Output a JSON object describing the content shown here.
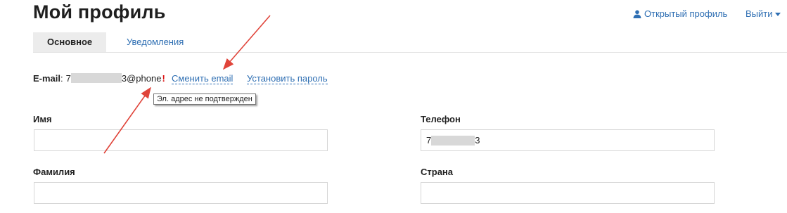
{
  "page": {
    "title": "Мой профиль"
  },
  "top_links": {
    "open_profile": "Открытый профиль",
    "logout": "Выйти"
  },
  "tabs": [
    {
      "label": "Основное",
      "active": true
    },
    {
      "label": "Уведомления",
      "active": false
    }
  ],
  "email": {
    "label": "E-mail",
    "value_start": "7",
    "value_end": "3@phone",
    "warning_mark": "!",
    "change_label": "Сменить email",
    "set_password_label": "Установить пароль",
    "tooltip": "Эл. адрес не подтвержден"
  },
  "form": {
    "name_label": "Имя",
    "name_value": "",
    "lastname_label": "Фамилия",
    "lastname_value": "",
    "phone_label": "Телефон",
    "phone_value_start": "7",
    "phone_value_end": "3",
    "country_label": "Страна",
    "country_value": ""
  },
  "colors": {
    "link": "#2f6fb3",
    "warning": "#dd1111",
    "arrow": "#e0443a",
    "active_tab_bg": "#ececec"
  },
  "icons": {
    "open_profile": "user-icon",
    "logout": "caret-down-icon"
  }
}
